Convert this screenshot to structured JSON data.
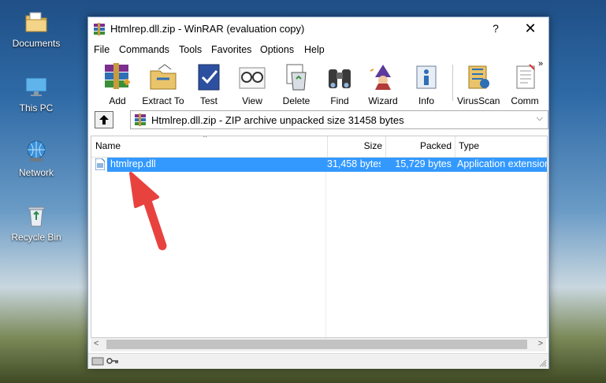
{
  "desktop": {
    "icons": [
      {
        "label": "Documents",
        "icon": "documents-folder-icon"
      },
      {
        "label": "This PC",
        "icon": "this-pc-icon"
      },
      {
        "label": "Network",
        "icon": "network-icon"
      },
      {
        "label": "Recycle Bin",
        "icon": "recycle-bin-icon"
      }
    ]
  },
  "window": {
    "title": "Htmlrep.dll.zip - WinRAR (evaluation copy)",
    "help_label": "?",
    "close_label": "✕"
  },
  "menu": [
    "File",
    "Commands",
    "Tools",
    "Favorites",
    "Options",
    "Help"
  ],
  "toolbar": [
    {
      "label": "Add",
      "icon": "add-books-icon"
    },
    {
      "label": "Extract To",
      "icon": "extract-folder-icon"
    },
    {
      "label": "Test",
      "icon": "test-check-icon"
    },
    {
      "label": "View",
      "icon": "view-glasses-icon"
    },
    {
      "label": "Delete",
      "icon": "delete-recycle-icon"
    },
    {
      "label": "Find",
      "icon": "find-binoculars-icon"
    },
    {
      "label": "Wizard",
      "icon": "wizard-icon"
    },
    {
      "label": "Info",
      "icon": "info-icon"
    },
    {
      "label": "VirusScan",
      "icon": "virusscan-icon"
    },
    {
      "label": "Comm",
      "icon": "comment-icon"
    }
  ],
  "toolbar_more": "»",
  "address": {
    "text": "Htmlrep.dll.zip - ZIP archive unpacked size 31458 bytes",
    "dropdown": "⌵"
  },
  "columns": {
    "name": "Name",
    "size": "Size",
    "packed": "Packed",
    "type": "Type"
  },
  "files": [
    {
      "name": "htmlrep.dll",
      "size": "31,458 bytes",
      "packed": "15,729 bytes",
      "type": "Application extension"
    }
  ],
  "scroll": {
    "left": "<",
    "right": ">"
  },
  "colors": {
    "selection": "#3399ff",
    "arrow": "#e8423e"
  }
}
